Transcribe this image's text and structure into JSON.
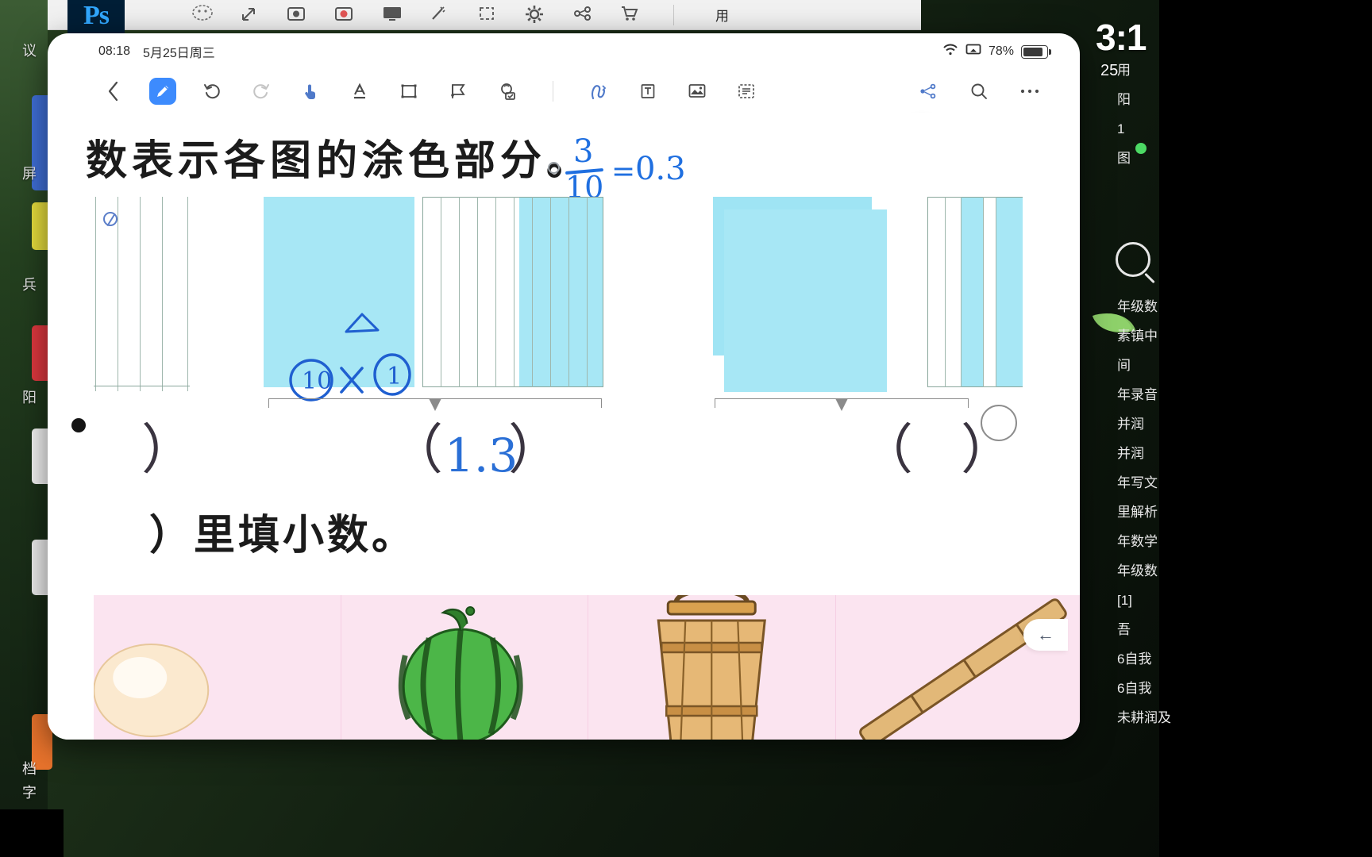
{
  "desktop": {
    "clock": "3:1",
    "date": "25",
    "side_labels": [
      "议",
      "屏",
      "兵",
      "阳",
      "档",
      "字"
    ],
    "right_labels": [
      "用",
      "阳",
      "1",
      "图",
      "年级数",
      "素镇中",
      "间",
      "年录音",
      "并润",
      "并润",
      "年写文",
      "里解析",
      "年数学",
      "年级数",
      "[1]",
      "吾",
      "6自我",
      "6自我",
      "未耕润及"
    ]
  },
  "photoshop": {
    "logo": "Ps",
    "cn_label": "用",
    "tools": [
      "ellipse-select-icon",
      "move-icon",
      "camera-icon",
      "record-icon",
      "monitor-icon",
      "wand-icon",
      "crop-icon",
      "gear-icon",
      "link-icon",
      "cart-icon"
    ]
  },
  "tablet": {
    "status": {
      "time": "08:18",
      "date": "5月25日周三",
      "wifi_icon": "wifi-icon",
      "cast_icon": "cast-icon",
      "battery_percent": "78%"
    },
    "toolbar": {
      "back_icon": "chevron-left-icon",
      "tools": [
        {
          "name": "pen-tool",
          "icon": "pencil-icon",
          "active": true
        },
        {
          "name": "undo-tool",
          "icon": "undo-icon",
          "active": false
        },
        {
          "name": "redo-tool",
          "icon": "redo-icon",
          "active": false
        },
        {
          "name": "hand-tool",
          "icon": "hand-pointer-icon",
          "active": false
        },
        {
          "name": "text-format-tool",
          "icon": "text-underline-icon",
          "active": false
        },
        {
          "name": "shape-tool",
          "icon": "rectangle-icon",
          "active": false
        },
        {
          "name": "flag-tool",
          "icon": "flag-icon",
          "active": false
        },
        {
          "name": "stamp-tool",
          "icon": "stamp-icon",
          "active": false
        },
        {
          "name": "lasso-tool",
          "icon": "squiggle-icon",
          "active": false
        },
        {
          "name": "textbox-tool",
          "icon": "text-box-icon",
          "active": false
        },
        {
          "name": "image-tool",
          "icon": "image-icon",
          "active": false
        },
        {
          "name": "list-tool",
          "icon": "list-icon",
          "active": false
        }
      ],
      "right_tools": [
        {
          "name": "share-button",
          "icon": "share-icon"
        },
        {
          "name": "search-button",
          "icon": "search-icon"
        },
        {
          "name": "more-button",
          "icon": "more-horizontal-icon"
        }
      ]
    },
    "worksheet": {
      "question_line_1": "数表示各图的涂色部分。",
      "question_line_2": "）里填小数。",
      "ink": {
        "fraction_numerator": "3",
        "fraction_denominator": "10",
        "equals": "=",
        "result": "0.3",
        "factor_left": "10",
        "operator": "×",
        "factor_right": "1"
      },
      "answers": [
        {
          "id": "answer-left",
          "open": "",
          "value": "",
          "close": "）"
        },
        {
          "id": "answer-middle",
          "open": "（",
          "value": "1.3",
          "close": "）"
        },
        {
          "id": "answer-right",
          "open": "（",
          "value": "",
          "close": "）"
        }
      ],
      "pictures": [
        {
          "name": "egg-picture",
          "label": "蛋"
        },
        {
          "name": "watermelon-picture",
          "label": "西瓜"
        },
        {
          "name": "bucket-picture",
          "label": "水桶"
        },
        {
          "name": "stick-picture",
          "label": "竹竿"
        }
      ],
      "back_fab_icon": "arrow-left-icon"
    }
  },
  "colors": {
    "accent": "#3d8bfd",
    "ink": "#1f6fe0",
    "fill": "#a7e7f5",
    "strip": "#fbe4f0"
  }
}
